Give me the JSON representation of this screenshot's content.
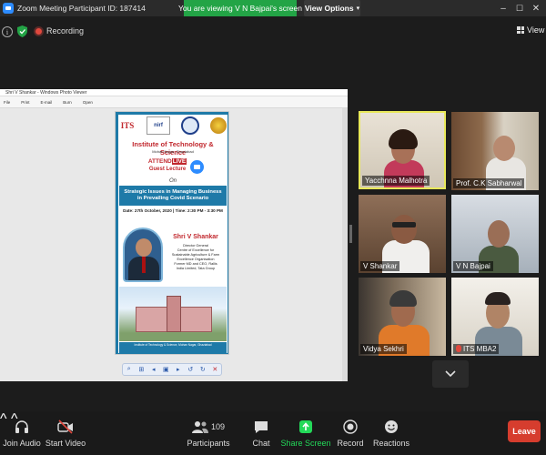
{
  "window": {
    "title": "Zoom Meeting Participant ID: 187414",
    "viewing_banner": "You are viewing V N Bajpai's screen",
    "view_options": "View Options",
    "minimize": "–",
    "maximize": "☐",
    "close": "✕"
  },
  "meeting_bar": {
    "recording_label": "Recording",
    "view_label": "View"
  },
  "shared_screen": {
    "viewer_title": "Shri V Shankar - Windows Photo Viewer",
    "menu": [
      "File",
      "Print",
      "E-mail",
      "Burn",
      "Open"
    ],
    "poster": {
      "title": "Institute of Technology & Science",
      "subtitle": "Mohan Nagar, Ghaziabad",
      "logo_its": "ITS",
      "logo_nirf": "nirf",
      "attend": "ATTEND",
      "live": "LIVE",
      "guest_lecture": "Guest Lecture",
      "on": "On",
      "topic_line1": "Strategic Issues in Managing Business",
      "topic_line2": "in Prevailing Covid Scenario",
      "date": "Date: 27th October, 2020 | Time: 2:30 PM - 3:30 PM",
      "speaker": "Shri V Shankar",
      "bio": [
        "Director General",
        "Centre of Excellence for",
        "Sustainable Agriculture & Farm",
        "Excellence Organisation",
        "Former MD and CEO, Rallis",
        "India Limited, Tata Group"
      ],
      "footer": "Institute of Technology & Science, Mohan Nagar, Ghaziabad"
    }
  },
  "participants_gallery": [
    {
      "name": "Yacchnna Malhotra",
      "muted": false,
      "active": true
    },
    {
      "name": "Prof. C.K Sabharwal",
      "muted": false,
      "active": false
    },
    {
      "name": "V Shankar",
      "muted": false,
      "active": false
    },
    {
      "name": "V N Bajpai",
      "muted": false,
      "active": false
    },
    {
      "name": "Vidya Sekhri",
      "muted": false,
      "active": false
    },
    {
      "name": "ITS MBA2",
      "muted": true,
      "active": false
    }
  ],
  "toolbar": {
    "join_audio": "Join Audio",
    "start_video": "Start Video",
    "participants": "Participants",
    "participant_count": "109",
    "chat": "Chat",
    "share_screen": "Share Screen",
    "record": "Record",
    "reactions": "Reactions",
    "leave": "Leave"
  },
  "colors": {
    "banner_green": "#23a446",
    "leave_red": "#d63d2e",
    "share_green": "#23d959",
    "active_speaker": "#e8e85a",
    "poster_blue": "#1e7aa8",
    "poster_red": "#c1272d"
  }
}
